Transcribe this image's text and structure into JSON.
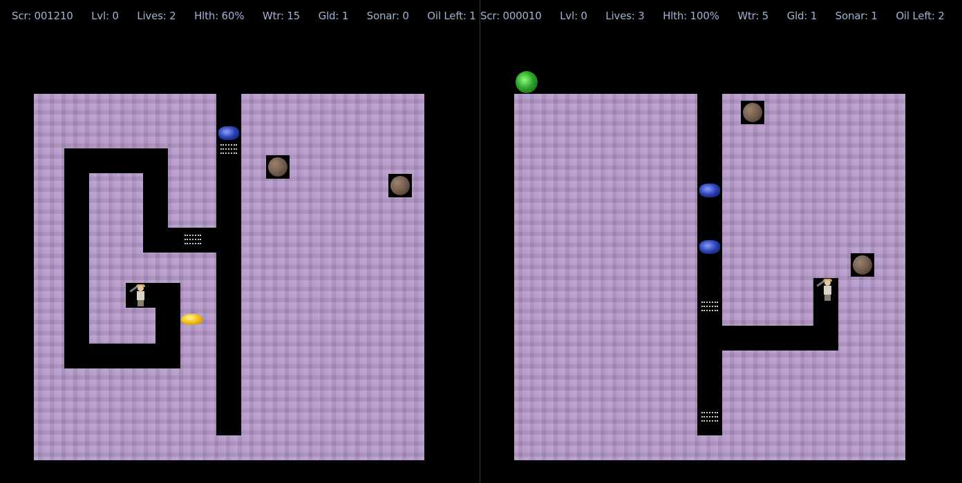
{
  "left": {
    "hud": {
      "score": "Scr: 001210",
      "level": "Lvl: 0",
      "lives": "Lives: 2",
      "health": "Hlth: 60%",
      "water": "Wtr: 15",
      "gold": "Gld: 1",
      "sonar": "Sonar: 0",
      "oil": "Oil Left: 1"
    }
  },
  "right": {
    "hud": {
      "score": "Scr: 000010",
      "level": "Lvl:  0",
      "lives": "Lives: 3",
      "health": "Hlth: 100%",
      "water": "Wtr:  5",
      "gold": "Gld:  1",
      "sonar": "Sonar:  1",
      "oil": "Oil Left:  2"
    }
  },
  "colors": {
    "background": "#000000",
    "dirt": "#b497c8",
    "hud_text": "#9fb4d0"
  },
  "icons": {
    "player": "digger-icon",
    "enemy": "protester-icon",
    "boulder": "boulder-icon",
    "water": "water-pool-icon",
    "gold": "gold-nugget-icon",
    "sonar": "sonar-kit-icon"
  }
}
